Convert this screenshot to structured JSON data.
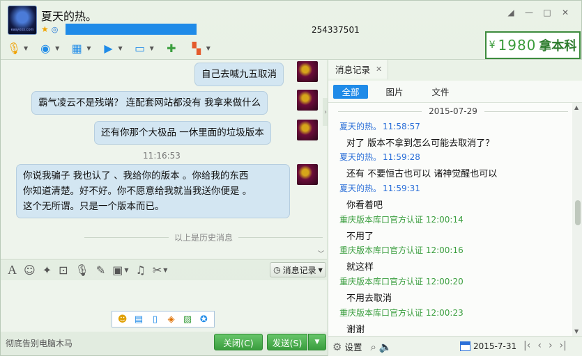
{
  "window": {
    "contact_name": "夏天的热。",
    "qq_number": "254337501",
    "controls": [
      "◢",
      "—",
      "□",
      "✕"
    ]
  },
  "avatar_logo_text": "easyxxx.com",
  "ad": {
    "number": "1980",
    "text": "拿本科",
    "prefix": "¥"
  },
  "toolbar": {
    "items": [
      {
        "name": "mic-icon",
        "glyph": "🎙"
      },
      {
        "name": "webcam-icon",
        "glyph": "◉"
      },
      {
        "name": "screen-share-icon",
        "glyph": "▦"
      },
      {
        "name": "send-file-icon",
        "glyph": "▶"
      },
      {
        "name": "remote-desktop-icon",
        "glyph": "▭"
      },
      {
        "name": "chat-add-icon",
        "glyph": "✚"
      },
      {
        "name": "apps-icon",
        "glyph": "▚"
      }
    ]
  },
  "chat": {
    "messages": [
      {
        "text": "自己去喊九五取消"
      },
      {
        "text": "霸气凌云不是残端？ 连配套网站都没有 我拿来做什么"
      },
      {
        "text": "还有你那个大极品 一休里面的垃圾版本"
      },
      {
        "timestamp": "11:16:53"
      },
      {
        "lines": [
          "你说我骗子 我也认了 、我给你的版本 。你给我的东西",
          "你知道清楚。好不好。你不愿意给我就当我送你便是 。",
          "这个无所谓。只是一个版本而已。"
        ]
      }
    ],
    "history_marker": "以上是历史消息"
  },
  "input_toolbar": {
    "history_button": "消息记录"
  },
  "footer": {
    "status_text": "彻底告别电脑木马",
    "close_button": "关闭(C)",
    "send_button": "发送(S)"
  },
  "right_panel": {
    "tab_title": "消息记录",
    "filters": [
      "全部",
      "图片",
      "文件"
    ],
    "date_header": "2015-07-29",
    "records": [
      {
        "sender": "夏天的热。",
        "time": "11:58:57",
        "side": "peer",
        "text": "对了  版本不拿到怎么可能去取消了？"
      },
      {
        "sender": "夏天的热。",
        "time": "11:59:28",
        "side": "peer",
        "text": "还有  不要恒古也可以  诸神觉醒也可以"
      },
      {
        "sender": "夏天的热。",
        "time": "11:59:31",
        "side": "peer",
        "text": "你看着吧"
      },
      {
        "sender": "重庆版本库口官方认证",
        "time": "12:00:14",
        "side": "me",
        "text": "不用了"
      },
      {
        "sender": "重庆版本库口官方认证",
        "time": "12:00:16",
        "side": "me",
        "text": "就这样"
      },
      {
        "sender": "重庆版本库口官方认证",
        "time": "12:00:20",
        "side": "me",
        "text": "不用去取消"
      },
      {
        "sender": "重庆版本库口官方认证",
        "time": "12:00:23",
        "side": "me",
        "text": "谢谢"
      }
    ],
    "footer_settings": "设置",
    "footer_date": "2015-7-31"
  }
}
